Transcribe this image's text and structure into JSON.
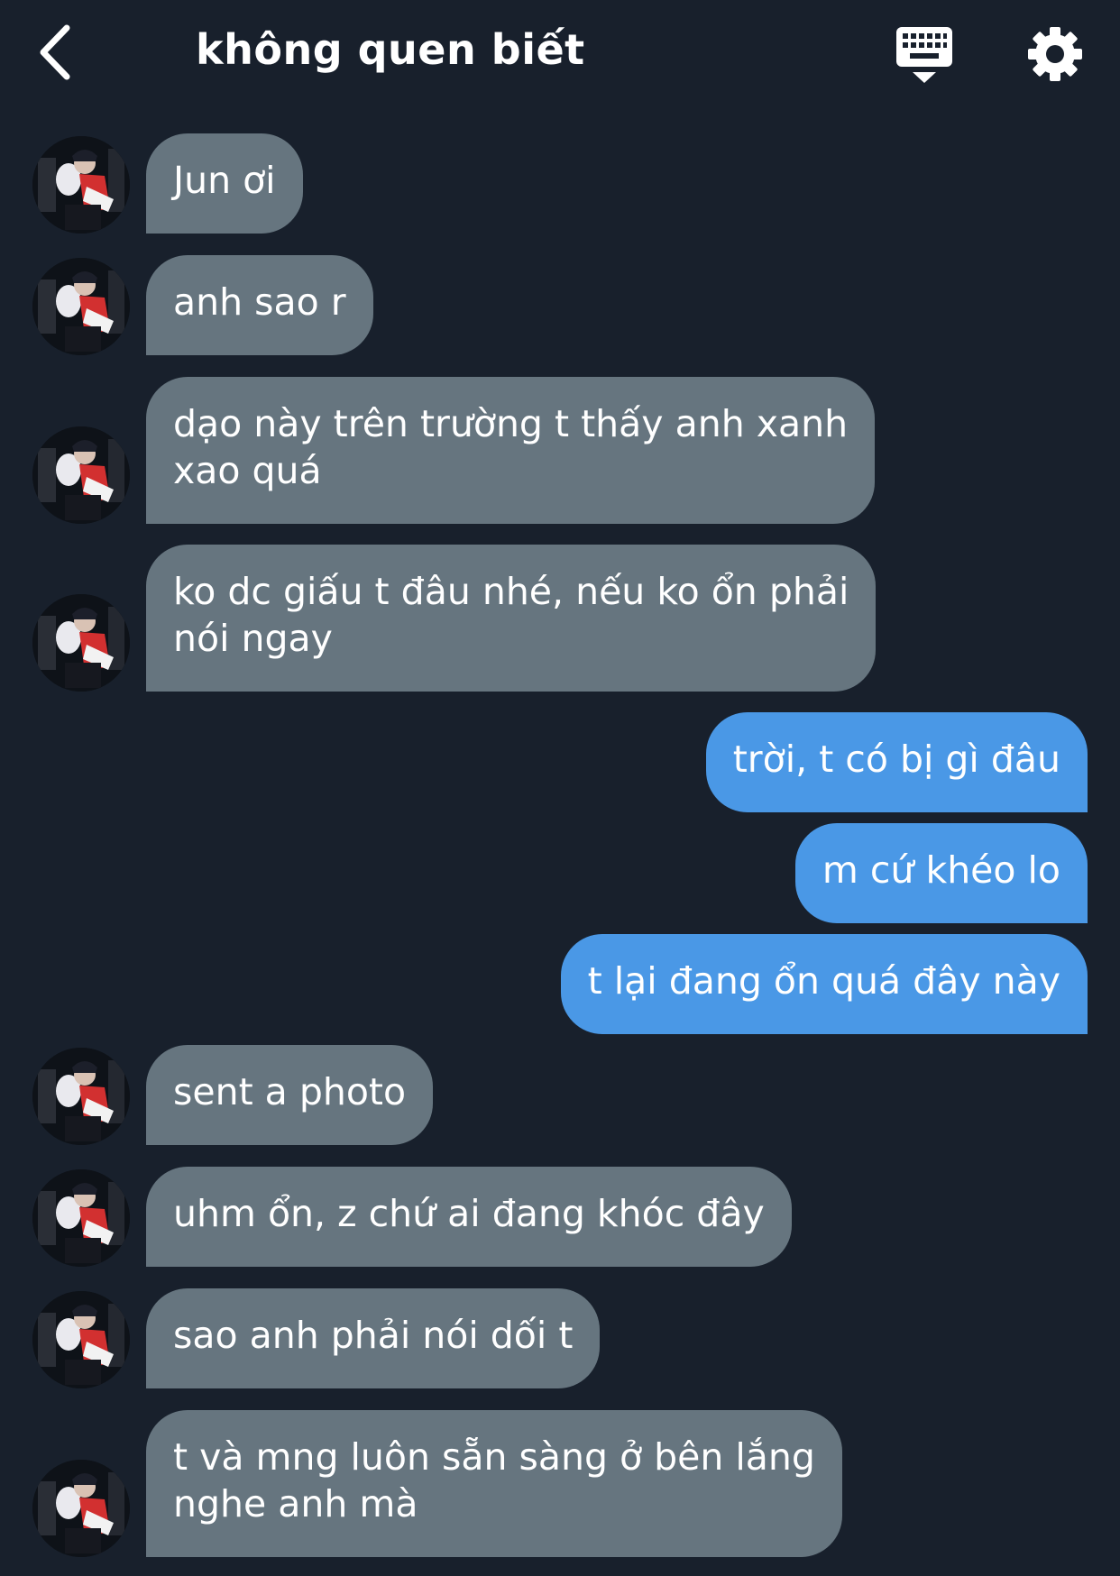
{
  "header": {
    "title": "không quen biết",
    "back_icon": "chevron-left-icon",
    "keyboard_icon": "keyboard-icon",
    "settings_icon": "gear-icon"
  },
  "colors": {
    "background": "#18202c",
    "incoming_bubble": "#66757f",
    "outgoing_bubble": "#4a98e6",
    "text": "#ffffff"
  },
  "messages": [
    {
      "dir": "in",
      "lines": [
        "Jun ơi"
      ]
    },
    {
      "dir": "in",
      "lines": [
        "anh sao r"
      ]
    },
    {
      "dir": "in",
      "lines": [
        "dạo này trên trường t thấy anh xanh",
        "xao quá"
      ]
    },
    {
      "dir": "in",
      "lines": [
        "ko dc giấu t đâu nhé, nếu ko ổn phải",
        "nói ngay"
      ]
    },
    {
      "dir": "out",
      "lines": [
        "trời, t có bị gì đâu"
      ]
    },
    {
      "dir": "out",
      "lines": [
        "m cứ khéo lo"
      ]
    },
    {
      "dir": "out",
      "lines": [
        "t lại đang ổn quá đây này"
      ]
    },
    {
      "dir": "in",
      "lines": [
        "sent a photo"
      ]
    },
    {
      "dir": "in",
      "lines": [
        "uhm ổn, z chứ ai đang khóc đây"
      ]
    },
    {
      "dir": "in",
      "lines": [
        "sao anh phải nói dối t"
      ]
    },
    {
      "dir": "in",
      "lines": [
        "t và mng luôn sẵn sàng ở bên lắng",
        "nghe anh mà"
      ]
    }
  ]
}
